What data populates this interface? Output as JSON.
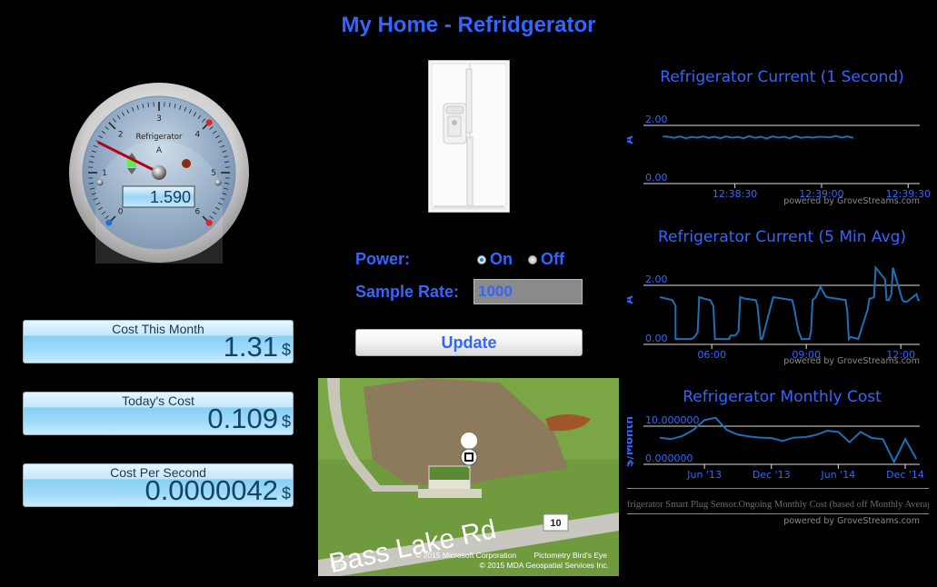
{
  "page": {
    "title": "My Home - Refridgerator"
  },
  "gauge": {
    "label": "Refrigerator",
    "unit": "A",
    "value": 1.59,
    "display": "1.590",
    "min": 0,
    "max": 6,
    "ticks": [
      "0",
      "1",
      "2",
      "3",
      "4",
      "5",
      "6"
    ],
    "low_marker": 0,
    "high_marker": 4,
    "max_marker": 6
  },
  "costs": [
    {
      "label": "Cost This Month",
      "value": "1.31",
      "currency": "$"
    },
    {
      "label": "Today's Cost",
      "value": "0.109",
      "currency": "$"
    },
    {
      "label": "Cost Per Second",
      "value": "0.0000042",
      "currency": "$"
    }
  ],
  "controls": {
    "power_label": "Power:",
    "power_options": [
      {
        "label": "On",
        "selected": true
      },
      {
        "label": "Off",
        "selected": false
      }
    ],
    "sample_rate_label": "Sample Rate:",
    "sample_rate_value": "1000",
    "update_label": "Update"
  },
  "map": {
    "road_label": "Bass Lake Rd",
    "route_shield": "10",
    "copyright_1": "© 2015 Microsoft Corporation",
    "copyright_2": "Pictometry Bird's Eye",
    "copyright_3": "© 2015 MDA Geospatial Services Inc.",
    "logo": "bing",
    "pin_icon": "device-pin-icon"
  },
  "colors": {
    "accent": "#3366ff",
    "series": "#1f6fb4",
    "grid": "#cccccc"
  },
  "chart_data": [
    {
      "id": "current-1s",
      "type": "line",
      "title": "Refrigerator Current (1 Second)",
      "ylabel": "A",
      "xlabel": "",
      "ylim": [
        0,
        2
      ],
      "ytick_labels": [
        "0.00",
        "2.00"
      ],
      "x_ticks": [
        "12:38:30",
        "12:39:00",
        "12:39:30"
      ],
      "x_range_seconds": [
        -26,
        64
      ],
      "x_tick_seconds": [
        0,
        30,
        60
      ],
      "x_seconds": [
        -25,
        -23,
        -21,
        -19,
        -17,
        -15,
        -13,
        -11,
        -9,
        -7,
        -5,
        -3,
        -1,
        1,
        3,
        5,
        7,
        9,
        11,
        13,
        15,
        17,
        19,
        21,
        23,
        25,
        27,
        29,
        31,
        33,
        35,
        37,
        39,
        41
      ],
      "values": [
        1.62,
        1.61,
        1.57,
        1.62,
        1.56,
        1.6,
        1.58,
        1.62,
        1.57,
        1.61,
        1.56,
        1.62,
        1.58,
        1.6,
        1.56,
        1.63,
        1.57,
        1.61,
        1.55,
        1.62,
        1.58,
        1.61,
        1.56,
        1.63,
        1.57,
        1.6,
        1.58,
        1.61,
        1.6,
        1.59,
        1.64,
        1.58,
        1.62,
        1.57
      ],
      "powered_by": "powered by GroveStreams.com"
    },
    {
      "id": "current-5min",
      "type": "line",
      "title": "Refrigerator Current (5 Min Avg)",
      "ylabel": "A",
      "xlabel": "",
      "ylim": [
        0,
        2
      ],
      "ytick_labels": [
        "0.00",
        "2.00"
      ],
      "x_ticks": [
        "06:00",
        "09:00",
        "12:00"
      ],
      "x_tick_hours": [
        6,
        9,
        12
      ],
      "x_range_hours": [
        4.35,
        12.6
      ],
      "x_hours": [
        4.35,
        4.55,
        4.75,
        4.85,
        4.85,
        5.1,
        5.35,
        5.45,
        5.55,
        5.6,
        5.75,
        5.95,
        6.05,
        6.1,
        6.2,
        6.55,
        6.6,
        6.75,
        6.85,
        6.9,
        7.05,
        7.4,
        7.45,
        7.55,
        7.6,
        7.95,
        8.55,
        8.6,
        8.75,
        8.85,
        9.1,
        9.15,
        9.2,
        9.3,
        9.45,
        9.6,
        9.65,
        10.25,
        10.3,
        10.35,
        10.4,
        10.6,
        10.65,
        10.95,
        11.0,
        11.05,
        11.15,
        11.2,
        11.5,
        11.55,
        11.6,
        11.62,
        11.7,
        11.75,
        12.05,
        12.1,
        12.15,
        12.2,
        12.5,
        12.55,
        12.6
      ],
      "values": [
        1.6,
        1.55,
        1.5,
        1.3,
        0.18,
        0.18,
        0.18,
        0.25,
        0.4,
        1.6,
        1.55,
        1.5,
        1.3,
        0.18,
        0.18,
        0.18,
        0.3,
        0.3,
        0.45,
        1.6,
        1.55,
        1.5,
        1.3,
        0.18,
        0.18,
        1.6,
        1.5,
        1.3,
        0.45,
        0.18,
        0.18,
        0.45,
        1.5,
        1.6,
        1.95,
        1.65,
        1.6,
        1.5,
        1.1,
        0.18,
        0.25,
        0.2,
        0.18,
        1.2,
        1.55,
        1.55,
        1.6,
        2.6,
        2.2,
        1.5,
        1.5,
        1.5,
        1.7,
        2.6,
        1.5,
        1.45,
        1.45,
        1.45,
        1.7,
        1.5,
        1.5
      ],
      "powered_by": "powered by GroveStreams.com"
    },
    {
      "id": "monthly-cost",
      "type": "line",
      "title": "Refrigerator Monthly Cost",
      "ylabel": "$/Month",
      "xlabel": "",
      "ylim": [
        0,
        10
      ],
      "ytick_labels": [
        "0.000000",
        "10.000000"
      ],
      "x_ticks": [
        "Jun '13",
        "Dec '13",
        "Jun '14",
        "Dec '14"
      ],
      "categories": [
        "Feb '13",
        "Mar '13",
        "Apr '13",
        "May '13",
        "Jun '13",
        "Jul '13",
        "Aug '13",
        "Sep '13",
        "Oct '13",
        "Nov '13",
        "Dec '13",
        "Jan '14",
        "Feb '14",
        "Mar '14",
        "Apr '14",
        "May '14",
        "Jun '14",
        "Jul '14",
        "Aug '14",
        "Sep '14",
        "Oct '14",
        "Nov '14",
        "Dec '14",
        "Jan '15"
      ],
      "values": [
        7.0,
        6.6,
        7.4,
        9.0,
        11.6,
        12.2,
        9.0,
        7.8,
        7.3,
        7.0,
        6.9,
        6.1,
        7.0,
        7.1,
        7.7,
        8.8,
        8.5,
        5.8,
        8.5,
        6.9,
        6.6,
        0.6,
        6.6,
        1.4
      ],
      "legend": "frigerator Smart Plug Sensor.Ongoing Monthly Cost (based off Monthly Average C",
      "powered_by": "powered by GroveStreams.com"
    }
  ]
}
